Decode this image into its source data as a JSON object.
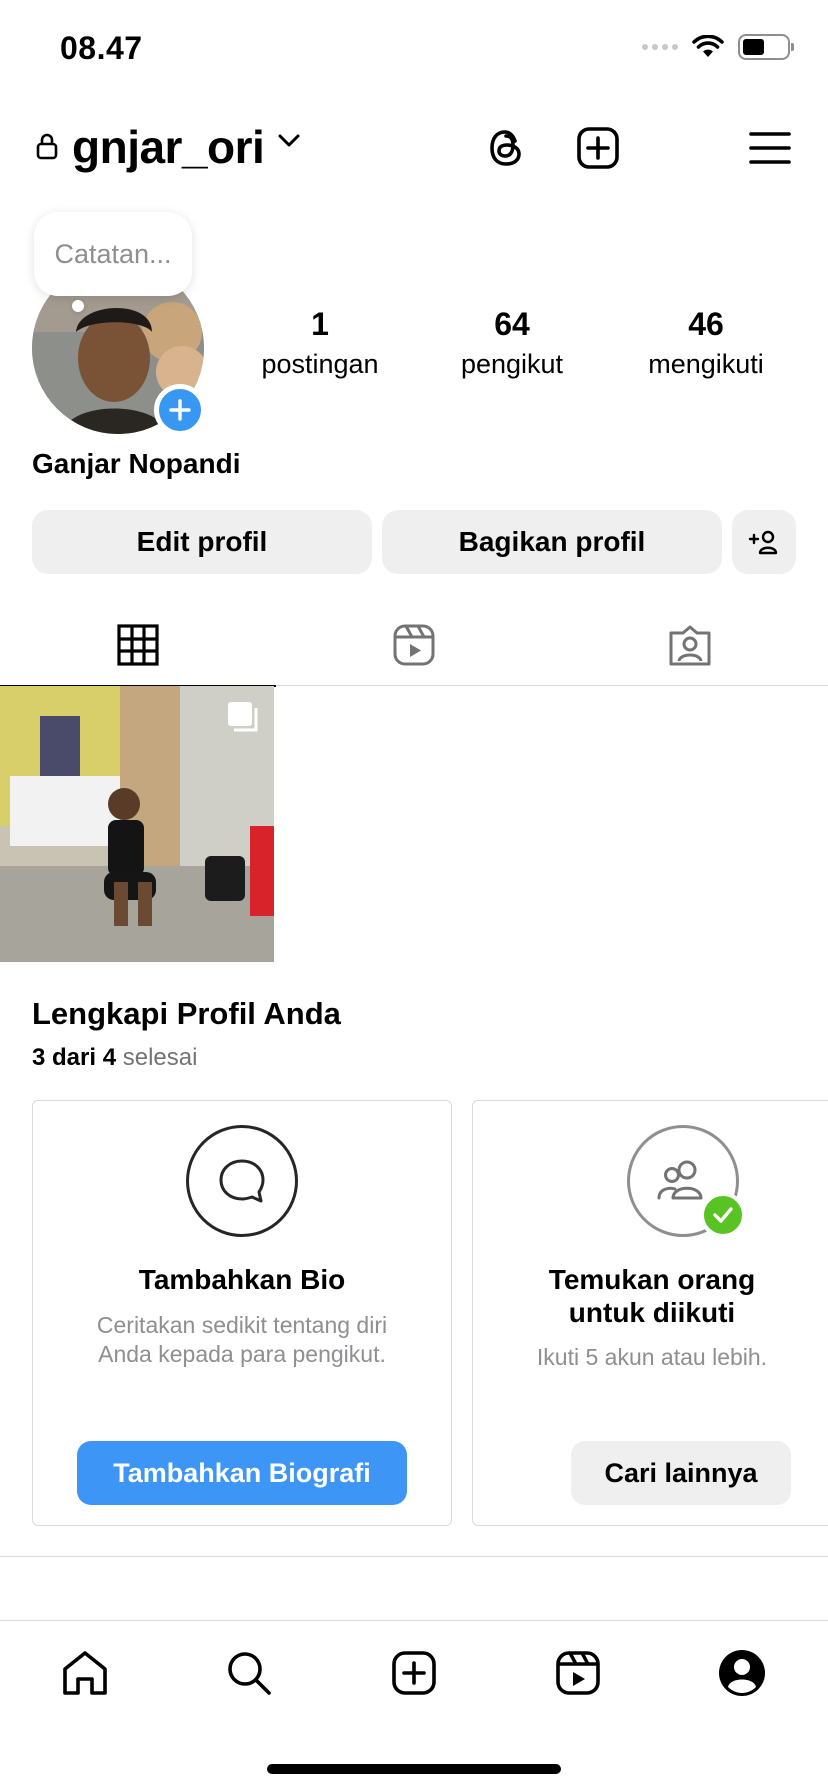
{
  "status_bar": {
    "time": "08.47"
  },
  "header": {
    "username": "gnjar_ori"
  },
  "note": {
    "placeholder": "Catatan..."
  },
  "stats": [
    {
      "value": "1",
      "label": "postingan"
    },
    {
      "value": "64",
      "label": "pengikut"
    },
    {
      "value": "46",
      "label": "mengikuti"
    }
  ],
  "profile": {
    "full_name": "Ganjar Nopandi"
  },
  "actions": {
    "edit": "Edit profil",
    "share": "Bagikan profil"
  },
  "tabs": [
    {
      "icon": "grid-icon",
      "active": true
    },
    {
      "icon": "reels-icon",
      "active": false
    },
    {
      "icon": "tagged-icon",
      "active": false
    }
  ],
  "complete_profile": {
    "title": "Lengkapi Profil Anda",
    "progress_bold": "3 dari 4",
    "progress_rest": "selesai",
    "cards": [
      {
        "title": "Tambahkan Bio",
        "desc_line1": "Ceritakan sedikit tentang diri",
        "desc_line2": "Anda kepada para pengikut.",
        "button": "Tambahkan Biografi"
      },
      {
        "title_line1": "Temukan orang",
        "title_line2": "untuk diikuti",
        "desc": "Ikuti 5 akun atau lebih.",
        "button": "Cari lainnya"
      }
    ]
  },
  "colors": {
    "accent": "#3d96f5",
    "success": "#58c322",
    "button_grey": "#efefef",
    "border": "#dbdbdb"
  },
  "bottom_nav": [
    "home-icon",
    "search-icon",
    "create-icon",
    "reels-icon",
    "profile-icon"
  ]
}
